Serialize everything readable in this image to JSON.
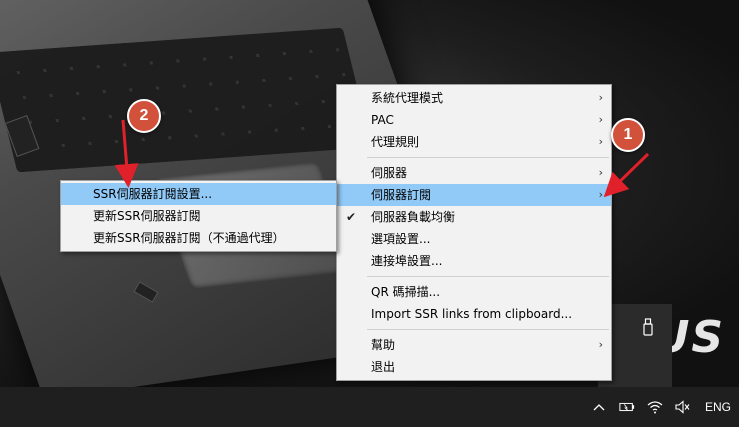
{
  "wallpaper": {
    "brand_text": "SUS"
  },
  "main_menu": {
    "groups": [
      [
        {
          "label": "系統代理模式",
          "submenu": true
        },
        {
          "label": "PAC",
          "submenu": true
        },
        {
          "label": "代理規則",
          "submenu": true
        }
      ],
      [
        {
          "label": "伺服器",
          "submenu": true
        },
        {
          "label": "伺服器訂閱",
          "submenu": true,
          "highlighted": true
        },
        {
          "label": "伺服器負載均衡",
          "checked": true
        },
        {
          "label": "選項設置..."
        },
        {
          "label": "連接埠設置..."
        }
      ],
      [
        {
          "label": "QR 碼掃描..."
        },
        {
          "label": "Import SSR links from clipboard..."
        }
      ],
      [
        {
          "label": "幫助",
          "submenu": true
        },
        {
          "label": "退出"
        }
      ]
    ]
  },
  "sub_menu": {
    "items": [
      {
        "label": "SSR伺服器訂閱設置...",
        "highlighted": true
      },
      {
        "label": "更新SSR伺服器訂閱"
      },
      {
        "label": "更新SSR伺服器訂閱（不通過代理）"
      }
    ]
  },
  "callouts": {
    "one": "1",
    "two": "2"
  },
  "taskbar": {
    "language": "ENG"
  },
  "colors": {
    "highlight": "#91c9f7",
    "callout": "#d2513b",
    "arrow": "#e0202a"
  }
}
